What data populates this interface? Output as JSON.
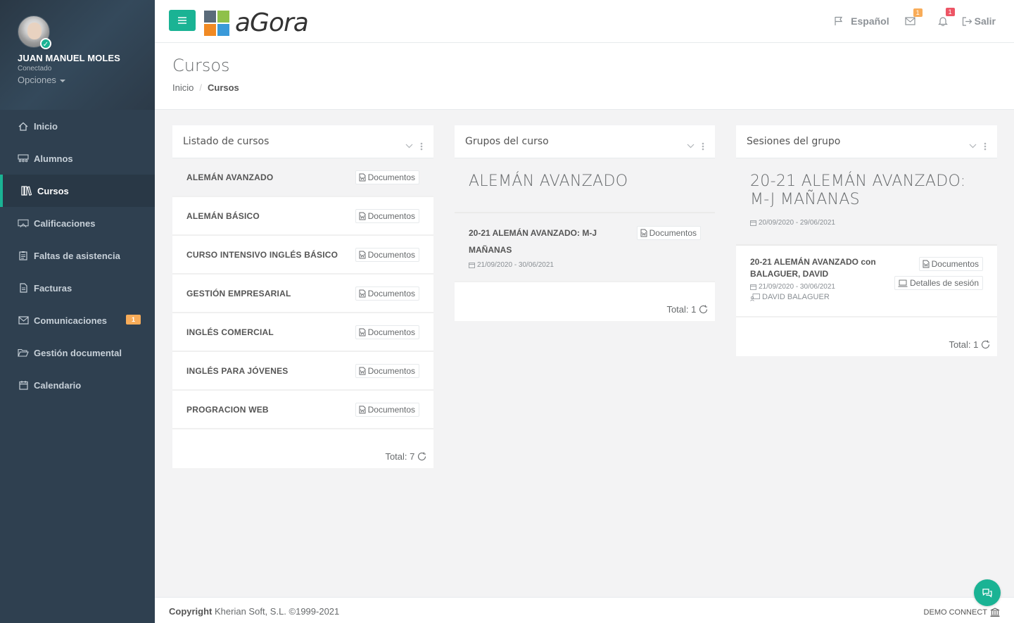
{
  "user": {
    "name": "JUAN MANUEL MOLES",
    "status": "Conectado",
    "options_label": "Opciones"
  },
  "sidebar": {
    "items": [
      {
        "label": "Inicio",
        "icon": "home-icon"
      },
      {
        "label": "Alumnos",
        "icon": "students-icon"
      },
      {
        "label": "Cursos",
        "icon": "books-icon",
        "active": true
      },
      {
        "label": "Calificaciones",
        "icon": "grades-icon"
      },
      {
        "label": "Faltas de asistencia",
        "icon": "clipboard-icon"
      },
      {
        "label": "Facturas",
        "icon": "invoice-icon"
      },
      {
        "label": "Comunicaciones",
        "icon": "envelope-icon",
        "badge": "1"
      },
      {
        "label": "Gestión documental",
        "icon": "folder-open-icon"
      },
      {
        "label": "Calendario",
        "icon": "calendar-icon"
      }
    ]
  },
  "topbar": {
    "logo_text": "aGora",
    "language": "Español",
    "mail_badge": "1",
    "bell_badge": "1",
    "logout": "Salir"
  },
  "page": {
    "title": "Cursos",
    "breadcrumb": [
      "Inicio",
      "Cursos"
    ]
  },
  "courses_panel": {
    "title": "Listado de cursos",
    "doc_label": "Documentos",
    "courses": [
      "ALEMÁN AVANZADO",
      "ALEMÁN BÁSICO",
      "CURSO INTENSIVO INGLÉS BÁSICO",
      "GESTIÓN EMPRESARIAL",
      "INGLÉS COMERCIAL",
      "INGLÉS PARA JÓVENES",
      "PROGRACION WEB"
    ],
    "total": "Total: 7"
  },
  "groups_panel": {
    "title": "Grupos del curso",
    "course_heading": "ALEMÁN AVANZADO",
    "group_name_line1": "20-21 ALEMÁN AVANZADO: M-J",
    "group_name_line2": "MAÑANAS",
    "group_dates": "21/09/2020 - 30/06/2021",
    "doc_label": "Documentos",
    "total": "Total: 1"
  },
  "sessions_panel": {
    "title": "Sesiones del grupo",
    "group_heading_line1": "20-21 ALEMÁN AVANZADO:",
    "group_heading_line2": "M-J MAÑANAS",
    "group_dates": "20/09/2020 - 29/06/2021",
    "session_line1": "20-21 ALEMÁN AVANZADO con",
    "session_line2": "BALAGUER, DAVID",
    "session_dates": "21/09/2020 - 30/06/2021",
    "teacher": "DAVID BALAGUER",
    "doc_label": "Documentos",
    "details_label": "Detalles de sesión",
    "total": "Total: 1"
  },
  "footer": {
    "copyright_bold": "Copyright",
    "copyright_rest": "Kherian Soft, S.L. ©1999-2021",
    "right_text": "DEMO CONNECT"
  },
  "colors": {
    "sidebar": "#2f4050",
    "accent": "#1ab394",
    "badge_orange": "#f8ac59",
    "badge_red": "#ed5565"
  }
}
